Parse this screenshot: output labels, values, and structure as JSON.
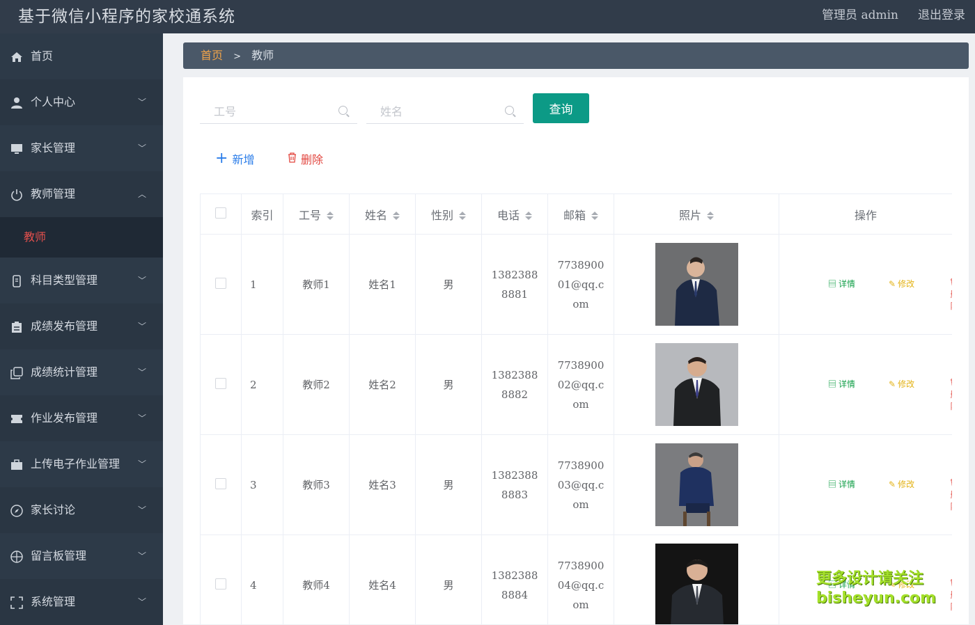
{
  "header": {
    "app_title": "基于微信小程序的家校通系统",
    "admin_label": "管理员 admin",
    "logout_label": "退出登录"
  },
  "sidebar": {
    "items": [
      {
        "label": "首页",
        "icon": "home-icon",
        "expandable": false
      },
      {
        "label": "个人中心",
        "icon": "user-icon",
        "expandable": true
      },
      {
        "label": "家长管理",
        "icon": "monitor-icon",
        "expandable": true
      },
      {
        "label": "教师管理",
        "icon": "power-icon",
        "expandable": true,
        "expanded": true
      },
      {
        "label": "科目类型管理",
        "icon": "phone-icon",
        "expandable": true
      },
      {
        "label": "成绩发布管理",
        "icon": "clipboard-icon",
        "expandable": true
      },
      {
        "label": "成绩统计管理",
        "icon": "copy-icon",
        "expandable": true
      },
      {
        "label": "作业发布管理",
        "icon": "ticket-icon",
        "expandable": true
      },
      {
        "label": "上传电子作业管理",
        "icon": "briefcase-icon",
        "expandable": true
      },
      {
        "label": "家长讨论",
        "icon": "compass-icon",
        "expandable": true
      },
      {
        "label": "留言板管理",
        "icon": "crosshair-icon",
        "expandable": true
      },
      {
        "label": "系统管理",
        "icon": "fullscreen-icon",
        "expandable": true
      }
    ],
    "active_subitem": "教师"
  },
  "breadcrumb": {
    "home": "首页",
    "separator": ">",
    "current": "教师"
  },
  "search": {
    "id_placeholder": "工号",
    "name_placeholder": "姓名",
    "query_label": "查询"
  },
  "actions": {
    "add_label": "新增",
    "delete_label": "删除"
  },
  "table": {
    "headers": {
      "index": "索引",
      "id": "工号",
      "name": "姓名",
      "gender": "性别",
      "phone": "电话",
      "email": "邮箱",
      "photo": "照片",
      "ops": "操作"
    },
    "op_labels": {
      "detail": "详情",
      "edit": "修改",
      "delete": "删除"
    },
    "rows": [
      {
        "index": "1",
        "id": "教师1",
        "name": "姓名1",
        "gender": "男",
        "phone": "13823888881",
        "email": "773890001@qq.com"
      },
      {
        "index": "2",
        "id": "教师2",
        "name": "姓名2",
        "gender": "男",
        "phone": "13823888882",
        "email": "773890002@qq.com"
      },
      {
        "index": "3",
        "id": "教师3",
        "name": "姓名3",
        "gender": "男",
        "phone": "13823888883",
        "email": "773890003@qq.com"
      },
      {
        "index": "4",
        "id": "教师4",
        "name": "姓名4",
        "gender": "男",
        "phone": "13823888884",
        "email": "773890004@qq.com"
      }
    ]
  },
  "watermark": {
    "line1": "更多设计请关注",
    "line2": "bisheyun.com"
  },
  "colors": {
    "topbar": "#313c4a",
    "sidebar": "#2d3a48",
    "accent_green": "#0c9a86",
    "active_red": "#e6504d",
    "breadcrumb_home": "#f0a44a"
  }
}
